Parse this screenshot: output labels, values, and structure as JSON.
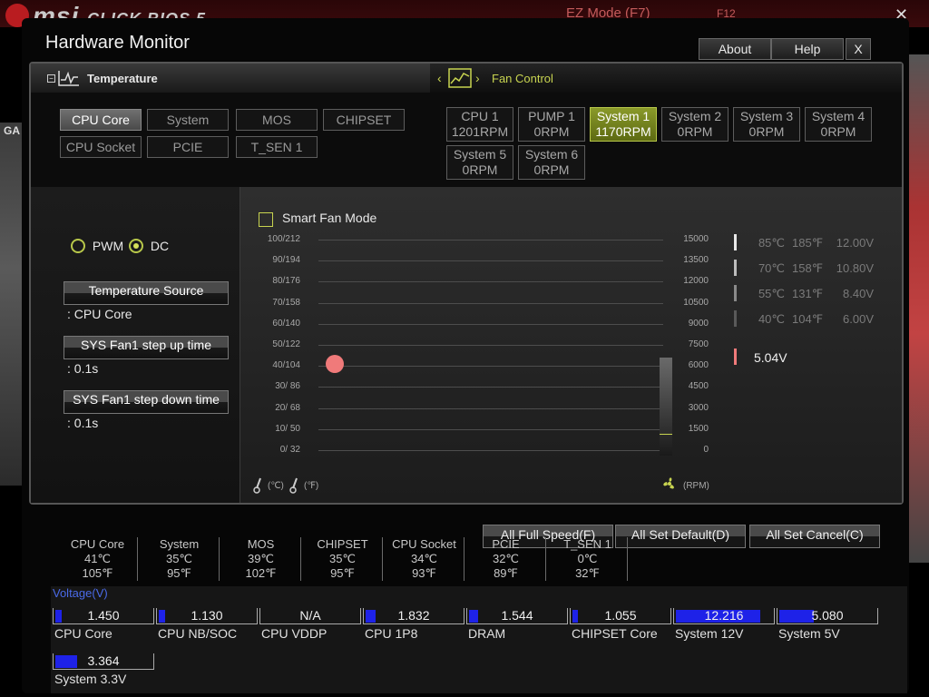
{
  "background_app": {
    "logo": "msi",
    "logo_suffix": "CLICK BIOS 5",
    "ez_mode": "EZ Mode (F7)",
    "f12": "F12",
    "left_tab": "GA"
  },
  "window": {
    "title": "Hardware Monitor",
    "about": "About",
    "help": "Help",
    "close": "X"
  },
  "sections": {
    "temperature": "Temperature",
    "fan_control": "Fan Control"
  },
  "temp_sources": [
    {
      "label": "CPU Core",
      "selected": true
    },
    {
      "label": "System",
      "selected": false
    },
    {
      "label": "MOS",
      "selected": false
    },
    {
      "label": "CHIPSET",
      "selected": false
    },
    {
      "label": "CPU Socket",
      "selected": false
    },
    {
      "label": "PCIE",
      "selected": false
    },
    {
      "label": "T_SEN 1",
      "selected": false
    }
  ],
  "fans": [
    {
      "name": "CPU 1",
      "rpm": "1201RPM",
      "selected": false
    },
    {
      "name": "PUMP 1",
      "rpm": "0RPM",
      "selected": false
    },
    {
      "name": "System 1",
      "rpm": "1170RPM",
      "selected": true
    },
    {
      "name": "System 2",
      "rpm": "0RPM",
      "selected": false
    },
    {
      "name": "System 3",
      "rpm": "0RPM",
      "selected": false
    },
    {
      "name": "System 4",
      "rpm": "0RPM",
      "selected": false
    },
    {
      "name": "System 5",
      "rpm": "0RPM",
      "selected": false
    },
    {
      "name": "System 6",
      "rpm": "0RPM",
      "selected": false
    }
  ],
  "mode": {
    "pwm": "PWM",
    "dc": "DC",
    "selected": "DC"
  },
  "settings": {
    "temp_source_btn": "Temperature Source",
    "temp_source_val": ": CPU Core",
    "step_up_btn": "SYS Fan1 step up time",
    "step_up_val": ": 0.1s",
    "step_down_btn": "SYS Fan1 step down time",
    "step_down_val": ": 0.1s"
  },
  "graph": {
    "smart_fan_mode": "Smart Fan Mode",
    "smart_fan_enabled": false,
    "left_ticks": [
      "100/212",
      "90/194",
      "80/176",
      "70/158",
      "60/140",
      "50/122",
      "40/104",
      "30/ 86",
      "20/ 68",
      "10/ 50",
      "0/ 32"
    ],
    "right_ticks": [
      "15000",
      "13500",
      "12000",
      "10500",
      "9000",
      "7500",
      "6000",
      "4500",
      "3000",
      "1500",
      "0"
    ],
    "unit_c": "(℃)",
    "unit_f": "(℉)",
    "unit_rpm": "(RPM)",
    "current_temp_c": 41,
    "fan_level_rpm": 1170
  },
  "voltage_legend": [
    {
      "c": "85℃",
      "f": "185℉",
      "v": "12.00V"
    },
    {
      "c": "70℃",
      "f": "158℉",
      "v": "10.80V"
    },
    {
      "c": "55℃",
      "f": "131℉",
      "v": "8.40V"
    },
    {
      "c": "40℃",
      "f": "104℉",
      "v": "6.00V"
    }
  ],
  "current_voltage": "5.04V",
  "actions": {
    "full_speed": "All Full Speed(F)",
    "set_default": "All Set Default(D)",
    "set_cancel": "All Set Cancel(C)"
  },
  "temps": [
    {
      "name": "CPU Core",
      "c": "41℃",
      "f": "105℉"
    },
    {
      "name": "System",
      "c": "35℃",
      "f": "95℉"
    },
    {
      "name": "MOS",
      "c": "39℃",
      "f": "102℉"
    },
    {
      "name": "CHIPSET",
      "c": "35℃",
      "f": "95℉"
    },
    {
      "name": "CPU Socket",
      "c": "34℃",
      "f": "93℉"
    },
    {
      "name": "PCIE",
      "c": "32℃",
      "f": "89℉"
    },
    {
      "name": "T_SEN 1",
      "c": "0℃",
      "f": "32℉"
    }
  ],
  "voltage_title": "Voltage(V)",
  "voltages": [
    {
      "name": "CPU Core",
      "value": "1.450",
      "fill": 0.07
    },
    {
      "name": "CPU NB/SOC",
      "value": "1.130",
      "fill": 0.07
    },
    {
      "name": "CPU VDDP",
      "value": "N/A",
      "fill": 0
    },
    {
      "name": "CPU 1P8",
      "value": "1.832",
      "fill": 0.1
    },
    {
      "name": "DRAM",
      "value": "1.544",
      "fill": 0.09
    },
    {
      "name": "CHIPSET Core",
      "value": "1.055",
      "fill": 0.06
    },
    {
      "name": "System 12V",
      "value": "12.216",
      "fill": 0.88
    },
    {
      "name": "System 5V",
      "value": "5.080",
      "fill": 0.36
    },
    {
      "name": "System 3.3V",
      "value": "3.364",
      "fill": 0.23
    }
  ],
  "colors": {
    "accent": "#c8d450",
    "fill_blue": "#1e22e8",
    "dot": "#f07a7a",
    "current_voltage": "#f07a7a"
  }
}
